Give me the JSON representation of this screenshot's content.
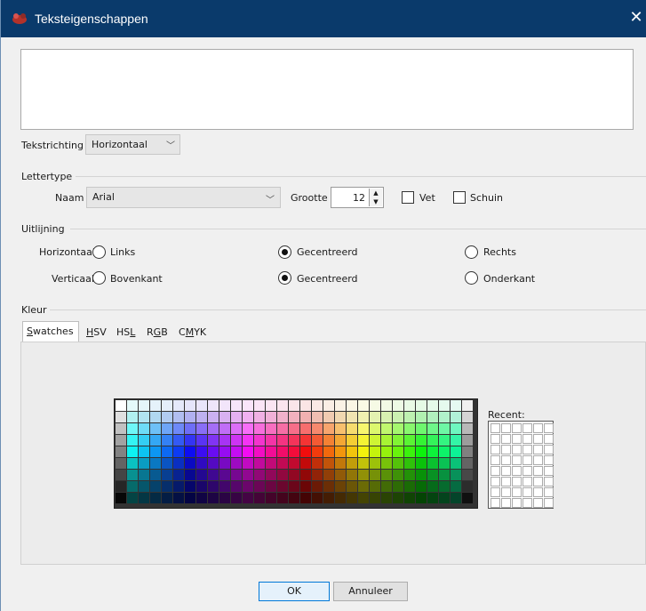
{
  "window": {
    "title": "Teksteigenschappen",
    "close_symbol": "✕"
  },
  "text_input": {
    "value": ""
  },
  "direction": {
    "label": "Tekstrichting",
    "value": "Horizontaal"
  },
  "font": {
    "section_label": "Lettertype",
    "name_label": "Naam",
    "name_value": "Arial",
    "size_label": "Grootte",
    "size_value": "12",
    "bold_label": "Vet",
    "bold_checked": false,
    "italic_label": "Schuin",
    "italic_checked": false
  },
  "alignment": {
    "section_label": "Uitlijning",
    "horizontal_label": "Horizontaal",
    "vertical_label": "Verticaal",
    "horizontal_options": [
      "Links",
      "Gecentreerd",
      "Rechts"
    ],
    "vertical_options": [
      "Bovenkant",
      "Gecentreerd",
      "Onderkant"
    ],
    "horizontal_selected": "Gecentreerd",
    "vertical_selected": "Gecentreerd"
  },
  "color": {
    "section_label": "Kleur",
    "tabs": [
      {
        "pre": "",
        "u": "S",
        "post": "watches"
      },
      {
        "pre": "",
        "u": "H",
        "post": "SV"
      },
      {
        "pre": "HS",
        "u": "L",
        "post": ""
      },
      {
        "pre": "R",
        "u": "G",
        "post": "B"
      },
      {
        "pre": "C",
        "u": "M",
        "post": "YK"
      }
    ],
    "active_tab": 0,
    "recent_label": "Recent:"
  },
  "buttons": {
    "ok": "OK",
    "cancel": "Annuleer"
  },
  "colors": {
    "titlebar": "#0a3a6b",
    "default_button_border": "#0078d7"
  }
}
